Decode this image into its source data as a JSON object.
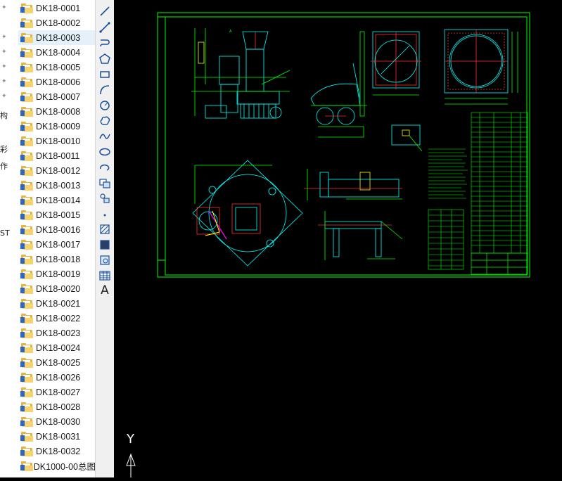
{
  "explorer": {
    "side_chars": [
      "构",
      "彩",
      "作",
      "ST"
    ],
    "files": [
      "DK18-0001",
      "DK18-0002",
      "DK18-0003",
      "DK18-0004",
      "DK18-0005",
      "DK18-0006",
      "DK18-0007",
      "DK18-0008",
      "DK18-0009",
      "DK18-0010",
      "DK18-0011",
      "DK18-0012",
      "DK18-0013",
      "DK18-0014",
      "DK18-0015",
      "DK18-0016",
      "DK18-0017",
      "DK18-0018",
      "DK18-0019",
      "DK18-0020",
      "DK18-0021",
      "DK18-0022",
      "DK18-0023",
      "DK18-0024",
      "DK18-0025",
      "DK18-0026",
      "DK18-0027",
      "DK18-0028",
      "DK18-0030",
      "DK18-0031",
      "DK18-0032",
      "DK1000-00总图"
    ],
    "selected_index": 2
  },
  "toolbar": {
    "tools": [
      "line-icon",
      "polyline-icon",
      "spline-3d-icon",
      "polygon-icon",
      "rectangle-icon",
      "arc-icon",
      "circle-icon",
      "revision-cloud-icon",
      "spline-icon",
      "ellipse-icon",
      "ellipse-arc-icon",
      "insert-block-icon",
      "make-block-icon",
      "point-icon",
      "hatch-icon",
      "gradient-icon",
      "region-icon",
      "table-icon",
      "text-icon"
    ],
    "text_tool_label": "A"
  },
  "ucs": {
    "y_label": "Y"
  },
  "colors": {
    "canvas_bg": "#000000",
    "frame": "#00ff00",
    "geometry": "#00ffff",
    "center_lines": "#ff3030",
    "highlight": "#ff00ff",
    "accent": "#ffff00"
  }
}
